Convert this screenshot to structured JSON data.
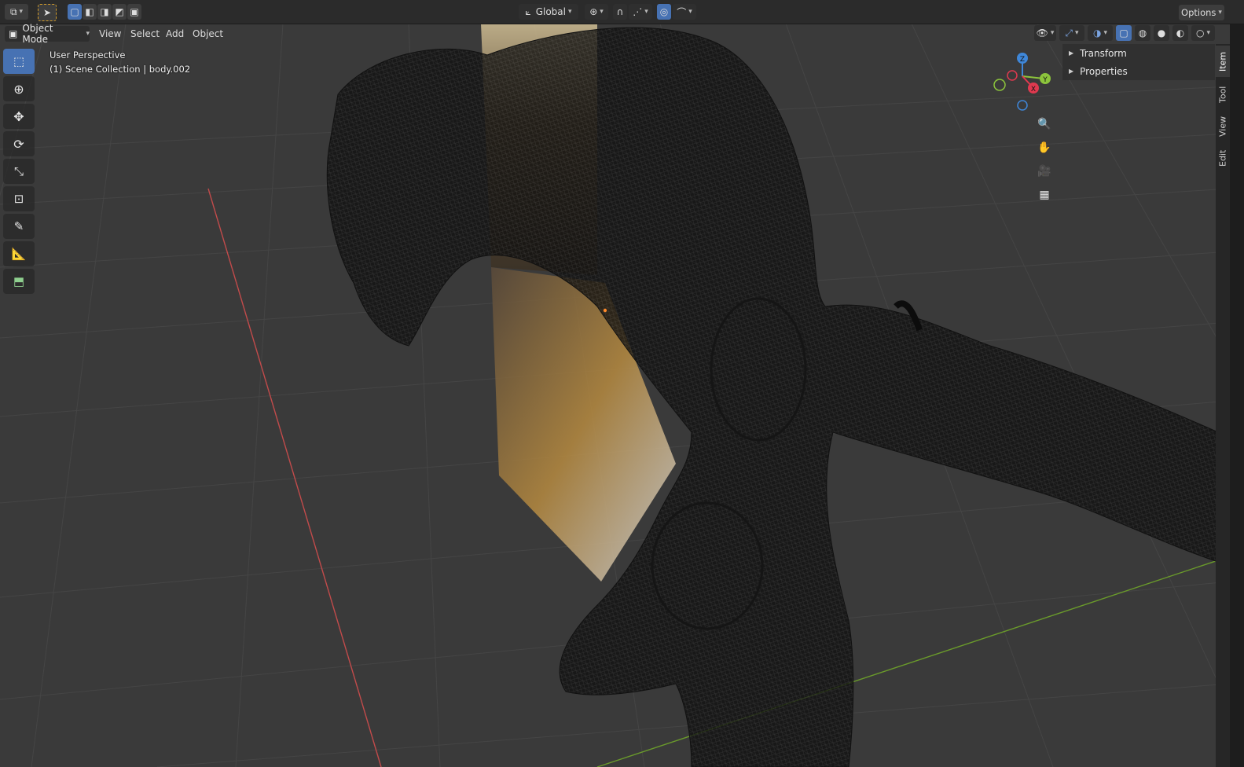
{
  "topbar": {
    "transform_orientation": "Global",
    "options_label": "Options"
  },
  "header": {
    "mode_label": "Object Mode",
    "menus": [
      "View",
      "Select",
      "Add",
      "Object"
    ]
  },
  "viewport": {
    "perspective_label": "User Perspective",
    "collection_label": "(1) Scene Collection | body.002"
  },
  "gizmo": {
    "z_label": "Z",
    "y_label": "Y",
    "x_label": "X",
    "colors": {
      "x": "#e0394f",
      "y": "#8cc43c",
      "z": "#3f87d9"
    }
  },
  "npanel": {
    "sections": [
      "Transform",
      "Properties"
    ]
  },
  "sidetabs": [
    "Item",
    "Tool",
    "View",
    "Edit"
  ],
  "toolbar": {
    "tools": [
      "select-box-tool",
      "cursor-tool",
      "move-tool",
      "rotate-tool",
      "scale-tool",
      "transform-tool",
      "annotate-tool",
      "measure-tool",
      "add-cube-tool"
    ]
  },
  "colors": {
    "accent": "#4772b3",
    "x_axis": "#c24b4b",
    "y_axis": "#6a9a2b",
    "grid_bg": "#3a3a3a"
  }
}
